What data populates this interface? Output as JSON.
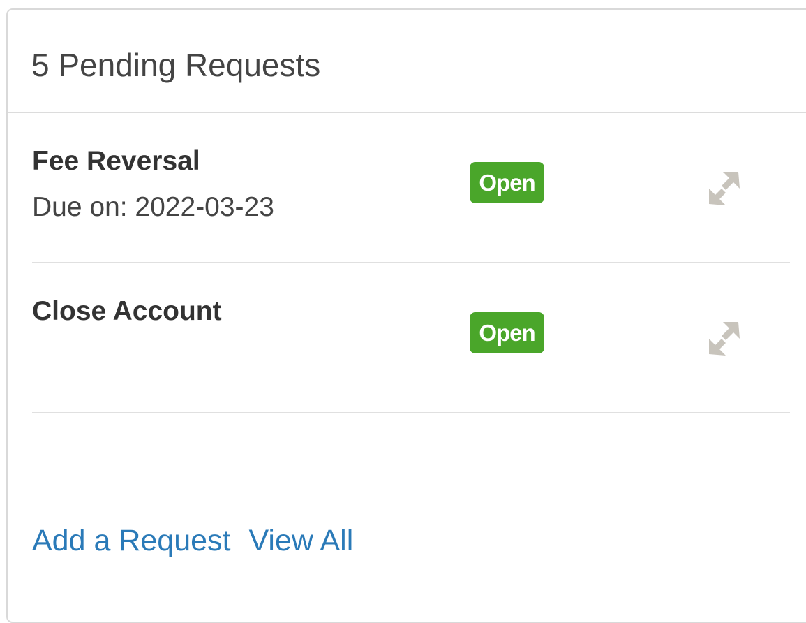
{
  "panel": {
    "title": "5 Pending Requests"
  },
  "requests": [
    {
      "title": "Fee Reversal",
      "due": "Due on: 2022-03-23",
      "status": "Open",
      "icon": "expand-icon"
    },
    {
      "title": "Close Account",
      "due": "",
      "status": "Open",
      "icon": "expand-icon"
    }
  ],
  "footer": {
    "add_label": "Add a Request",
    "view_all_label": "View All"
  },
  "colors": {
    "status_open": "#4aa62a",
    "link": "#2a7ab8",
    "icon": "#c8c4bc"
  }
}
